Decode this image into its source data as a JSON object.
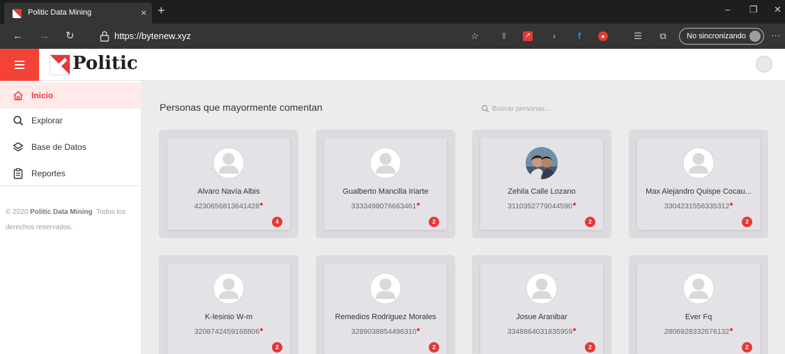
{
  "browser": {
    "tab_title": "Politic Data Mining",
    "tab_close": "×",
    "new_tab": "+",
    "url": "https://bytenew.xyz",
    "sync_label": "No sincronizando",
    "more": "···",
    "window_controls": {
      "minimize": "–",
      "restore": "❐",
      "close": "✕"
    }
  },
  "colors": {
    "accent": "#f44336",
    "badge": "#e53935",
    "active_bg": "#ffe9e9"
  },
  "app": {
    "logo_text": "Politic"
  },
  "sidebar": {
    "items": [
      {
        "label": "Inicio",
        "icon": "home-icon",
        "active": true
      },
      {
        "label": "Explorar",
        "icon": "search-icon"
      },
      {
        "label": "Base de Datos",
        "icon": "layers-icon"
      },
      {
        "label": "Reportes",
        "icon": "clipboard-icon"
      }
    ],
    "footer_prefix": "© 2020 ",
    "footer_brand": "Politic Data Mining",
    "footer_suffix": ". Todos los derechos reservados."
  },
  "main": {
    "title": "Personas que mayormente comentan",
    "search_placeholder": "Buscar personas...",
    "people": [
      {
        "name": "Alvaro Navía Albis",
        "id": "4230656813641428",
        "count": "4",
        "photo": false
      },
      {
        "name": "Gualberto Mancilla Iriarte",
        "id": "3333498076663461",
        "count": "2",
        "photo": false
      },
      {
        "name": "Zehila Calle Lozano",
        "id": "3110352779044590",
        "count": "2",
        "photo": true
      },
      {
        "name": "Max Alejandro Quispe Cocau...",
        "id": "3304231556335312",
        "count": "2",
        "photo": false
      },
      {
        "name": "K-lesinio W-m",
        "id": "3208742459168806",
        "count": "2",
        "photo": false
      },
      {
        "name": "Remedios Rodriguez Morales",
        "id": "3289038854496310",
        "count": "2",
        "photo": false
      },
      {
        "name": "Josue Aranibar",
        "id": "3348864031835959",
        "count": "2",
        "photo": false
      },
      {
        "name": "Ever Fq",
        "id": "2806928332676132",
        "count": "2",
        "photo": false
      }
    ]
  }
}
